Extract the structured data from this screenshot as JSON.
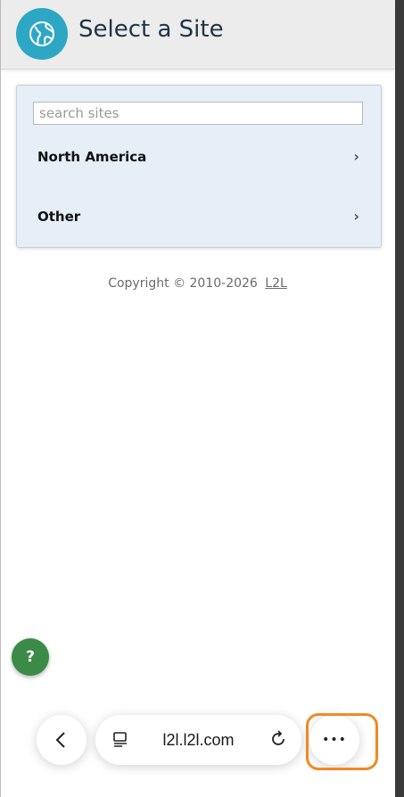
{
  "header": {
    "title": "Select a Site",
    "icon": "globe-icon"
  },
  "search": {
    "placeholder": "search sites",
    "value": ""
  },
  "sites": [
    {
      "label": "North America",
      "chevron": "›"
    },
    {
      "label": "Other",
      "chevron": "›"
    }
  ],
  "footer": {
    "copyright": "Copyright",
    "symbol": "©",
    "years": "2010-2026",
    "link": "L2L"
  },
  "help": {
    "label": "?"
  },
  "browser": {
    "url": "l2l.l2l.com",
    "more": "•••"
  },
  "colors": {
    "accent": "#2ea7c4",
    "help": "#3c8a47",
    "highlight": "#f08a24",
    "card": "#e6eef7"
  }
}
